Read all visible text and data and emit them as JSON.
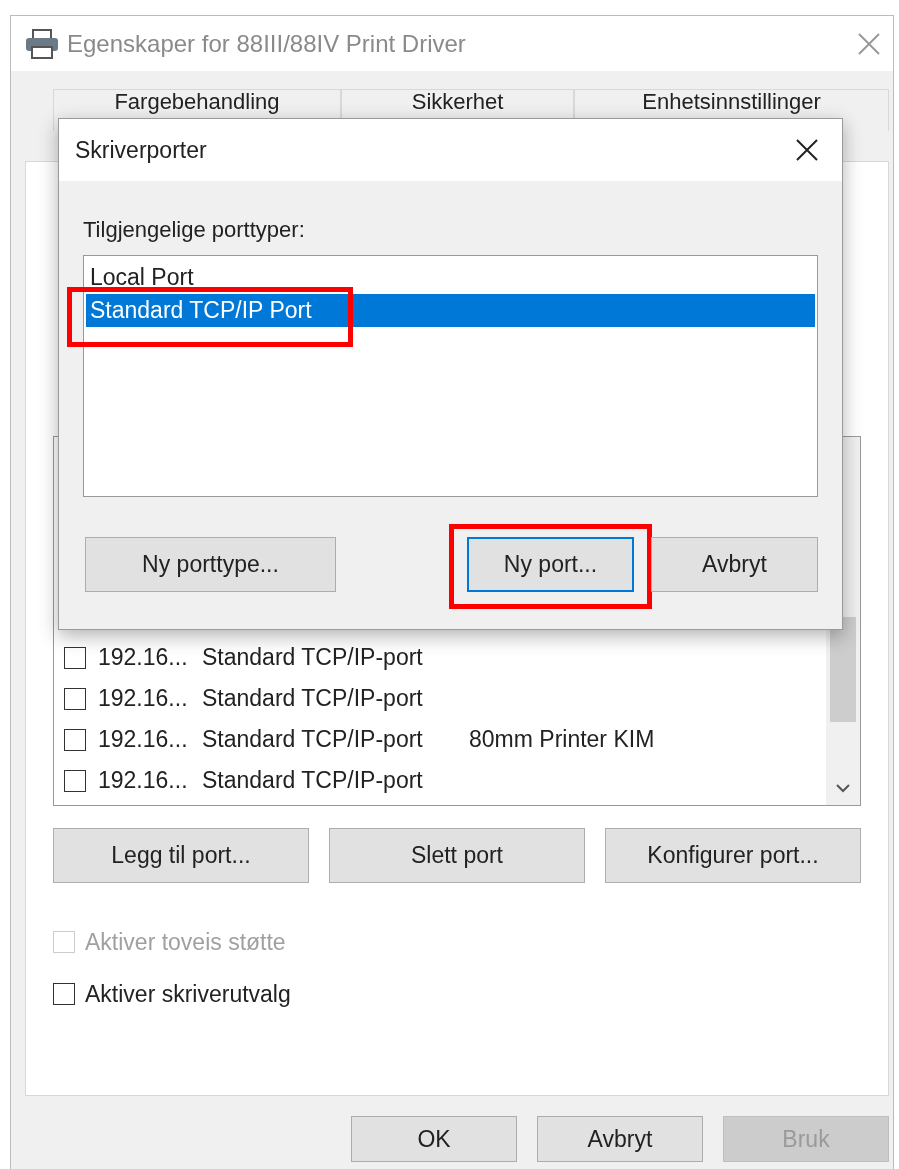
{
  "window": {
    "title": "Egenskaper for 88III/88IV Print Driver"
  },
  "tabs": [
    {
      "label": "Fargebehandling",
      "selected": false
    },
    {
      "label": "Sikkerhet",
      "selected": false
    },
    {
      "label": "Enhetsinnstillinger",
      "selected": false
    }
  ],
  "port_list": {
    "rows": [
      {
        "checked": false,
        "port": "192.16...",
        "description": "Standard TCP/IP-port",
        "printer": ""
      },
      {
        "checked": false,
        "port": "192.16...",
        "description": "Standard TCP/IP-port",
        "printer": ""
      },
      {
        "checked": false,
        "port": "192.16...",
        "description": "Standard TCP/IP-port",
        "printer": "80mm Printer KIM"
      },
      {
        "checked": false,
        "port": "192.16...",
        "description": "Standard TCP/IP-port",
        "printer": ""
      }
    ]
  },
  "port_buttons": [
    {
      "label": "Legg til port..."
    },
    {
      "label": "Slett port"
    },
    {
      "label": "Konfigurer port..."
    }
  ],
  "options": [
    {
      "label": "Aktiver toveis støtte",
      "checked": false,
      "disabled": true
    },
    {
      "label": "Aktiver skriverutvalg",
      "checked": false,
      "disabled": false
    }
  ],
  "footer_buttons": [
    {
      "label": "OK",
      "disabled": false
    },
    {
      "label": "Avbryt",
      "disabled": false
    },
    {
      "label": "Bruk",
      "disabled": true
    }
  ],
  "dialog": {
    "title": "Skriverporter",
    "label": "Tilgjengelige porttyper:",
    "port_types": [
      {
        "label": "Local Port",
        "selected": false,
        "highlighted": false
      },
      {
        "label": "Standard TCP/IP Port",
        "selected": true,
        "highlighted": true
      }
    ],
    "buttons": [
      {
        "label": "Ny porttype...",
        "focused": false,
        "highlighted": false
      },
      {
        "label": "Ny port...",
        "focused": true,
        "highlighted": true
      },
      {
        "label": "Avbryt",
        "focused": false,
        "highlighted": false
      }
    ]
  }
}
